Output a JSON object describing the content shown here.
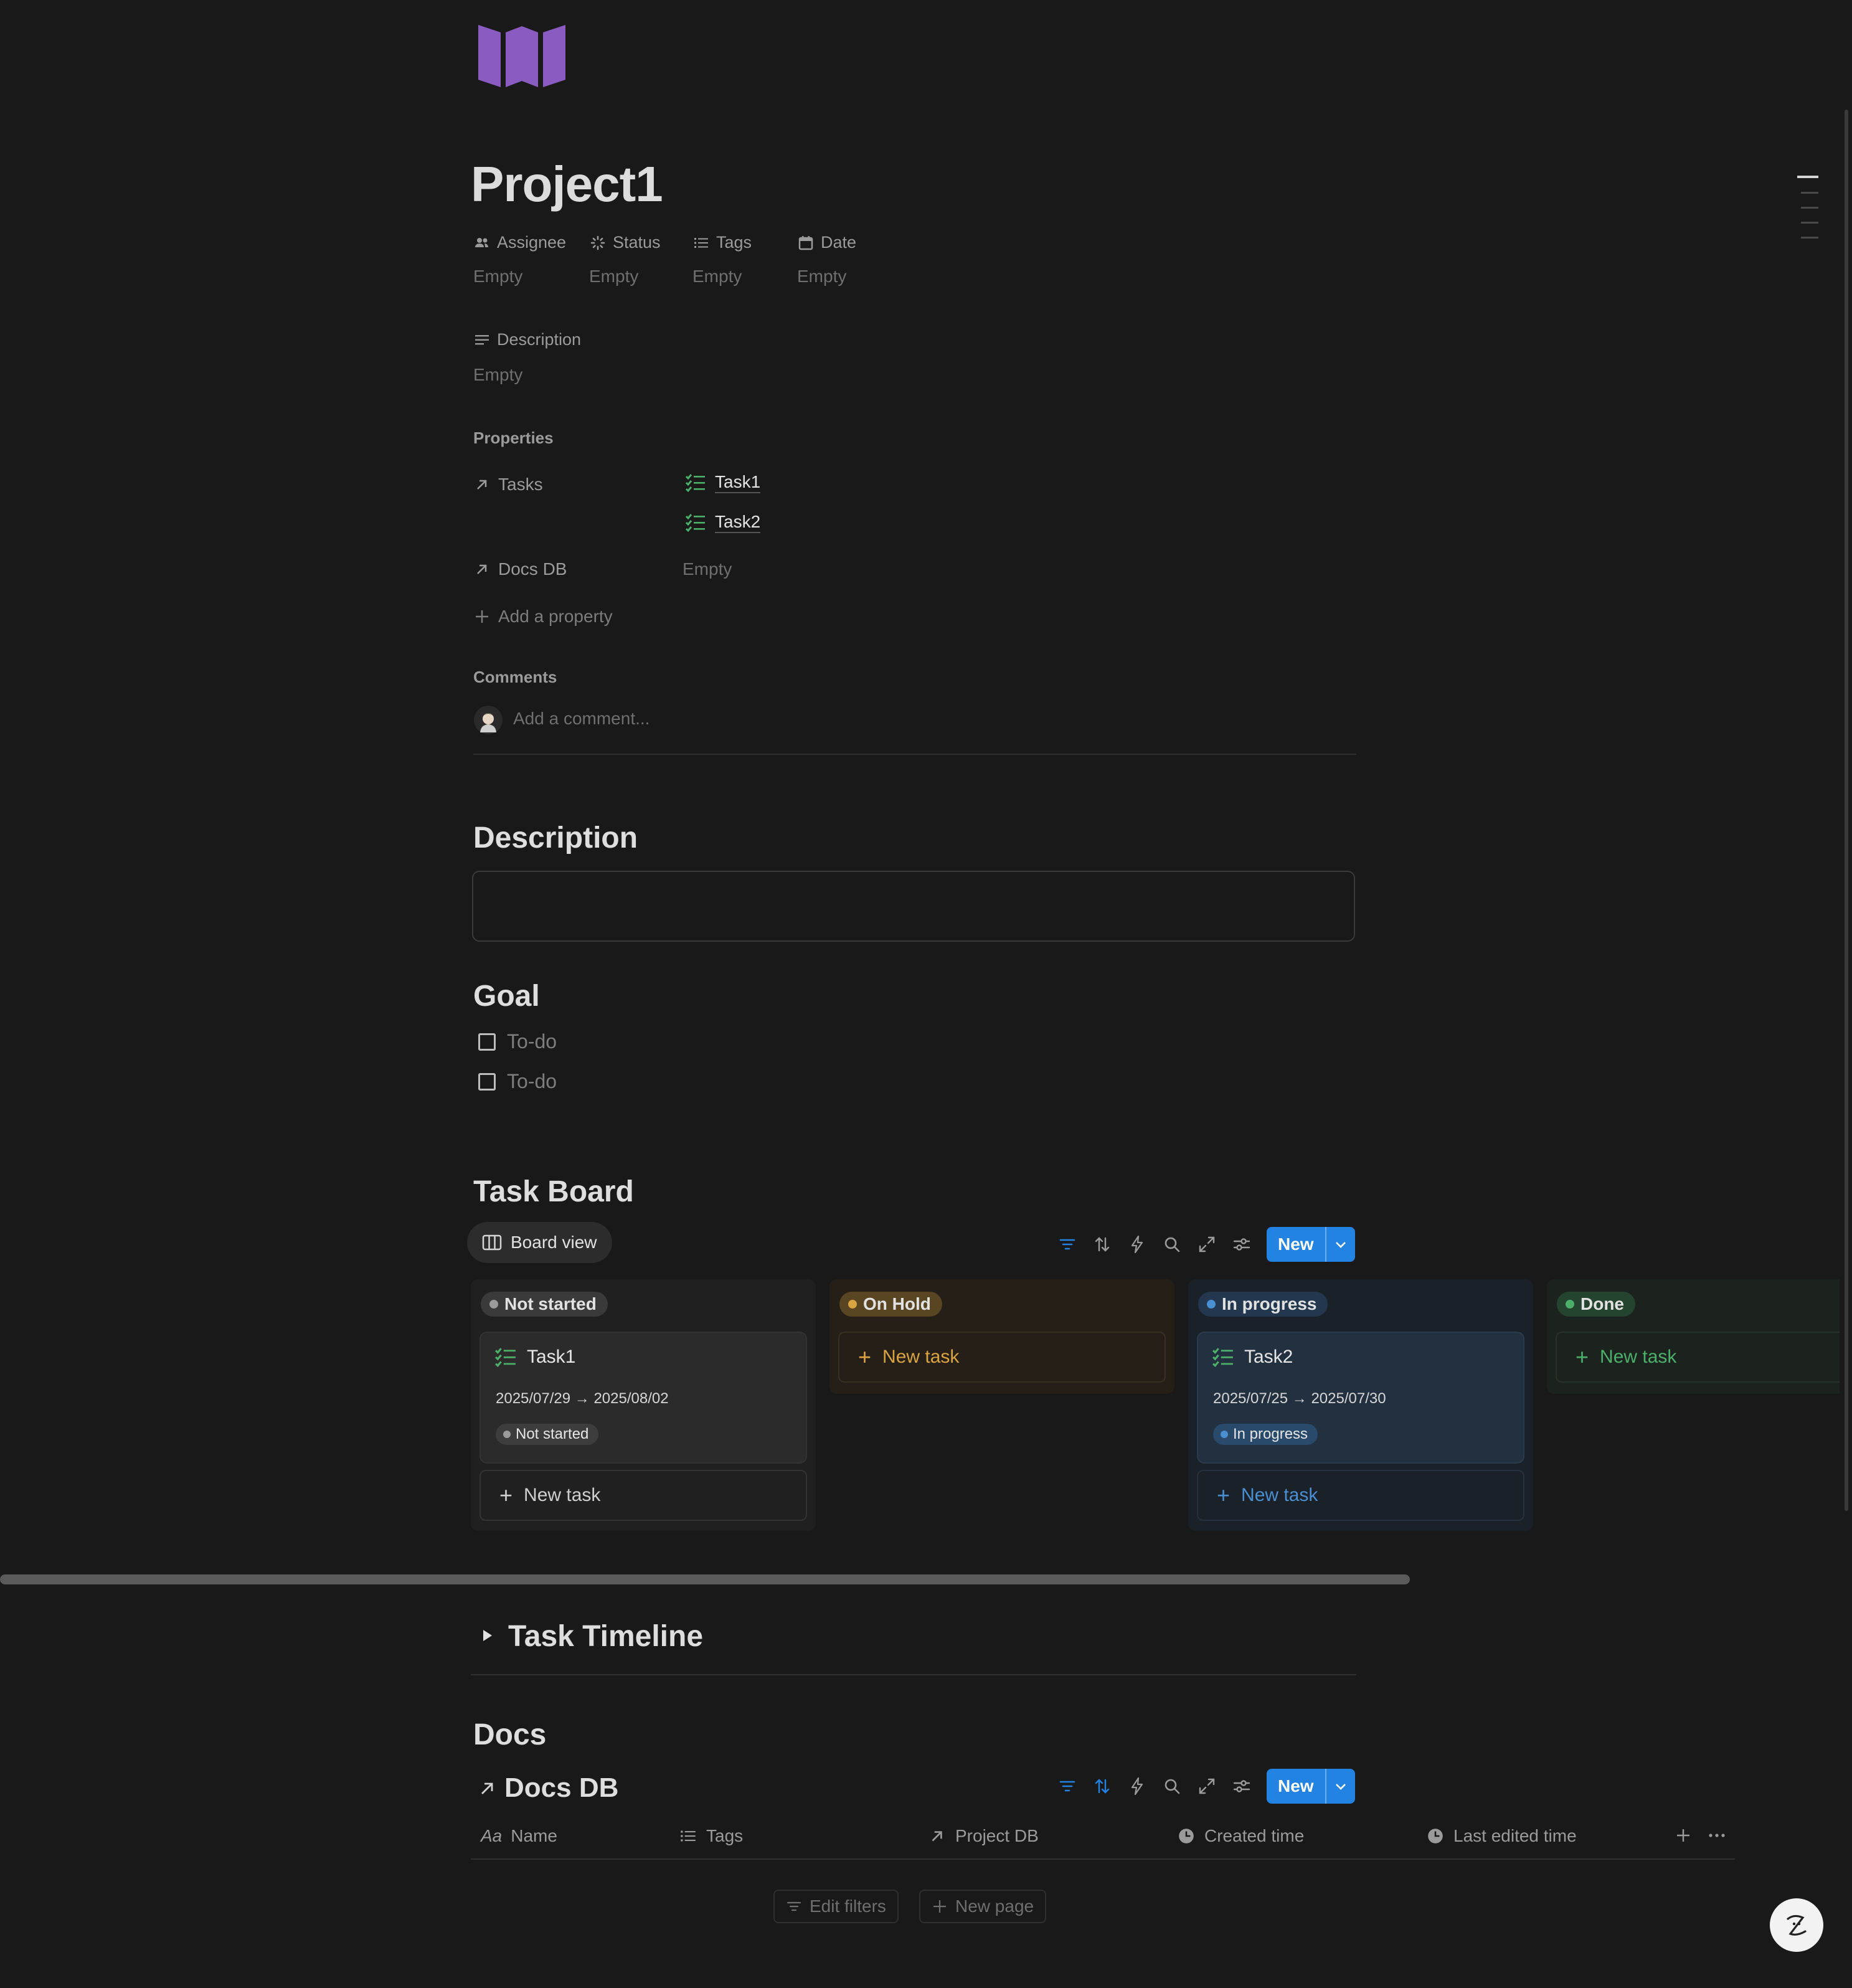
{
  "page": {
    "title": "Project1",
    "icon": "book-open-icon",
    "accent": "#8a5cc2"
  },
  "properties": {
    "assignee": {
      "label": "Assignee",
      "value": "Empty"
    },
    "status": {
      "label": "Status",
      "value": "Empty"
    },
    "tags": {
      "label": "Tags",
      "value": "Empty"
    },
    "date": {
      "label": "Date",
      "value": "Empty"
    },
    "description": {
      "label": "Description",
      "value": "Empty"
    },
    "section_label": "Properties",
    "tasks": {
      "label": "Tasks",
      "items": [
        "Task1",
        "Task2"
      ]
    },
    "docs_db": {
      "label": "Docs DB",
      "value": "Empty"
    },
    "add_property": "Add a property"
  },
  "comments": {
    "label": "Comments",
    "placeholder": "Add a comment..."
  },
  "description_section": {
    "heading": "Description"
  },
  "goal": {
    "heading": "Goal",
    "todos": [
      "To-do",
      "To-do"
    ]
  },
  "task_board": {
    "heading": "Task Board",
    "view_label": "Board view",
    "new_label": "New",
    "columns": [
      {
        "name": "Not started",
        "color": "#9b9b9b",
        "cards": [
          {
            "title": "Task1",
            "dates": "2025/07/29 → 2025/08/02",
            "status": "Not started"
          }
        ],
        "new_label": "New task"
      },
      {
        "name": "On Hold",
        "color": "#d9a441",
        "cards": [],
        "new_label": "New task"
      },
      {
        "name": "In progress",
        "color": "#4a8fd1",
        "cards": [
          {
            "title": "Task2",
            "dates": "2025/07/25 → 2025/07/30",
            "status": "In progress"
          }
        ],
        "new_label": "New task"
      },
      {
        "name": "Done",
        "color": "#4caf6a",
        "cards": [],
        "new_label": "New task"
      }
    ]
  },
  "task_timeline": {
    "heading": "Task Timeline"
  },
  "docs": {
    "heading": "Docs",
    "db_title": "Docs DB",
    "new_label": "New",
    "columns": [
      "Name",
      "Tags",
      "Project DB",
      "Created time",
      "Last edited time"
    ],
    "edit_filters": "Edit filters",
    "new_page": "New page"
  }
}
